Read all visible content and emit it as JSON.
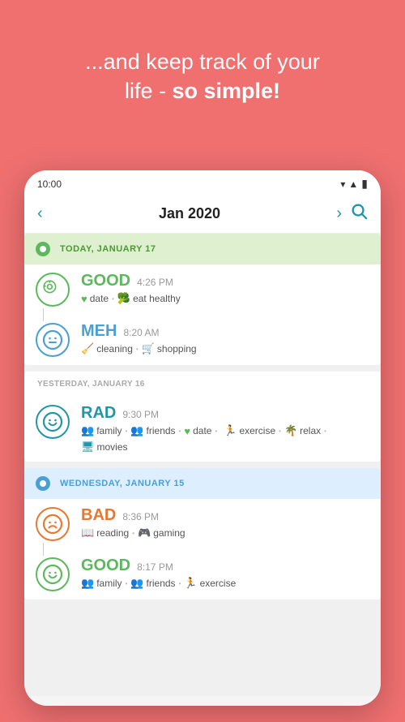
{
  "header": {
    "line1": "...and keep track of your",
    "line2": "life - ",
    "line2bold": "so simple!"
  },
  "status_bar": {
    "time": "10:00",
    "wifi": "▾",
    "signal": "▲",
    "battery": "▮"
  },
  "nav": {
    "prev_arrow": "‹",
    "title": "Jan 2020",
    "next_arrow": "›",
    "search_icon": "🔍"
  },
  "days": [
    {
      "id": "today",
      "header_label": "TODAY, JANUARY 17",
      "header_type": "today",
      "dot_color": "green",
      "label_color": "green",
      "entries": [
        {
          "mood": "GOOD",
          "mood_color": "green",
          "time": "4:26 PM",
          "face": "😊",
          "tags": [
            {
              "icon": "♥",
              "icon_color": "green",
              "label": "date"
            },
            {
              "icon": "🥦",
              "icon_color": "green",
              "label": "eat healthy"
            }
          ]
        },
        {
          "mood": "MEH",
          "mood_color": "blue",
          "time": "8:20 AM",
          "face": "😐",
          "tags": [
            {
              "icon": "🧹",
              "icon_color": "teal",
              "label": "cleaning"
            },
            {
              "icon": "🛒",
              "icon_color": "teal",
              "label": "shopping"
            }
          ]
        }
      ]
    },
    {
      "id": "yesterday",
      "header_sub": "YESTERDAY, JANUARY 16",
      "header_type": "yesterday",
      "dot_color": null,
      "entries": [
        {
          "mood": "RAD",
          "mood_color": "teal",
          "time": "9:30 PM",
          "face": "😄",
          "tags": [
            {
              "icon": "👥",
              "icon_color": "teal",
              "label": "family"
            },
            {
              "icon": "👥",
              "icon_color": "teal",
              "label": "friends"
            },
            {
              "icon": "♥",
              "icon_color": "green",
              "label": "date"
            },
            {
              "icon": "🏃",
              "icon_color": "teal",
              "label": "exercise"
            },
            {
              "icon": "🌴",
              "icon_color": "teal",
              "label": "relax"
            },
            {
              "icon": "🖥",
              "icon_color": "teal",
              "label": "movies"
            }
          ]
        }
      ]
    },
    {
      "id": "wednesday",
      "header_label": "WEDNESDAY, JANUARY 15",
      "header_type": "wednesday",
      "dot_color": "blue",
      "label_color": "blue",
      "entries": [
        {
          "mood": "BAD",
          "mood_color": "orange",
          "time": "8:36 PM",
          "face": "😟",
          "tags": [
            {
              "icon": "📖",
              "icon_color": "orange",
              "label": "reading"
            },
            {
              "icon": "🎮",
              "icon_color": "orange",
              "label": "gaming"
            }
          ]
        },
        {
          "mood": "GOOD",
          "mood_color": "green",
          "time": "8:17 PM",
          "face": "😊",
          "tags": [
            {
              "icon": "👥",
              "icon_color": "teal",
              "label": "family"
            },
            {
              "icon": "👥",
              "icon_color": "teal",
              "label": "friends"
            },
            {
              "icon": "🏃",
              "icon_color": "teal",
              "label": "exercise"
            }
          ]
        }
      ]
    }
  ]
}
